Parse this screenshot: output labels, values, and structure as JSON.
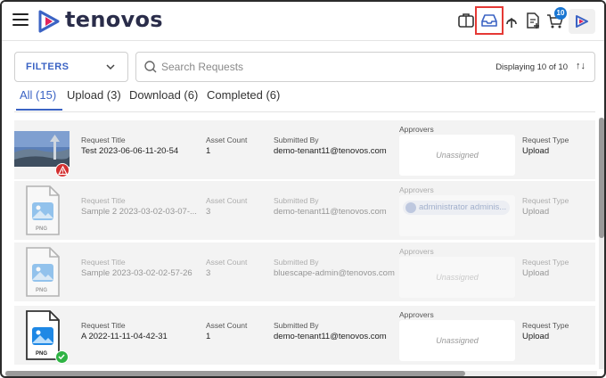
{
  "header": {
    "brand": "tenovos",
    "icons": [
      "menu-icon",
      "briefcase-icon",
      "inbox-icon",
      "upload-icon",
      "document-add-icon",
      "cart-icon",
      "app-logo-icon"
    ],
    "cart_count": "10"
  },
  "toolbar": {
    "filters_label": "FILTERS",
    "search_placeholder": "Search Requests",
    "display_text": "Displaying 10 of 10",
    "sort_glyph": "↑↓"
  },
  "tabs": [
    {
      "label": "All (15)",
      "active": true
    },
    {
      "label": "Upload (3)",
      "active": false
    },
    {
      "label": "Download (6)",
      "active": false
    },
    {
      "label": "Completed (6)",
      "active": false
    }
  ],
  "labels": {
    "request_title": "Request Title",
    "asset_count": "Asset Count",
    "submitted_by": "Submitted By",
    "approvers": "Approvers",
    "request_type": "Request Type"
  },
  "rows": [
    {
      "title": "Test 2023-06-06-11-20-54",
      "asset_count": "1",
      "submitted_by": "demo-tenant11@tenovos.com",
      "approver": "Unassigned",
      "type": "Upload",
      "thumb": "photo",
      "status": "warning"
    },
    {
      "title": "Sample 2 2023-03-02-03-07-...",
      "asset_count": "3",
      "submitted_by": "demo-tenant11@tenovos.com",
      "approver": "administrator adminis...",
      "type": "Upload",
      "thumb": "png"
    },
    {
      "title": "Sample 2023-03-02-02-57-26",
      "asset_count": "3",
      "submitted_by": "bluescape-admin@tenovos.com",
      "approver": "Unassigned",
      "type": "Upload",
      "thumb": "png"
    },
    {
      "title": "A 2022-11-11-04-42-31",
      "asset_count": "1",
      "submitted_by": "demo-tenant11@tenovos.com",
      "approver": "Unassigned",
      "type": "Upload",
      "thumb": "png",
      "status": "success"
    }
  ],
  "file_badge": "PNG",
  "colors": {
    "accent": "#3b63c4",
    "brand": "#2a2d4a",
    "badge": "#1976d2",
    "warning": "#d32f2f",
    "success": "#2e7d32",
    "highlight": "#e53935"
  }
}
